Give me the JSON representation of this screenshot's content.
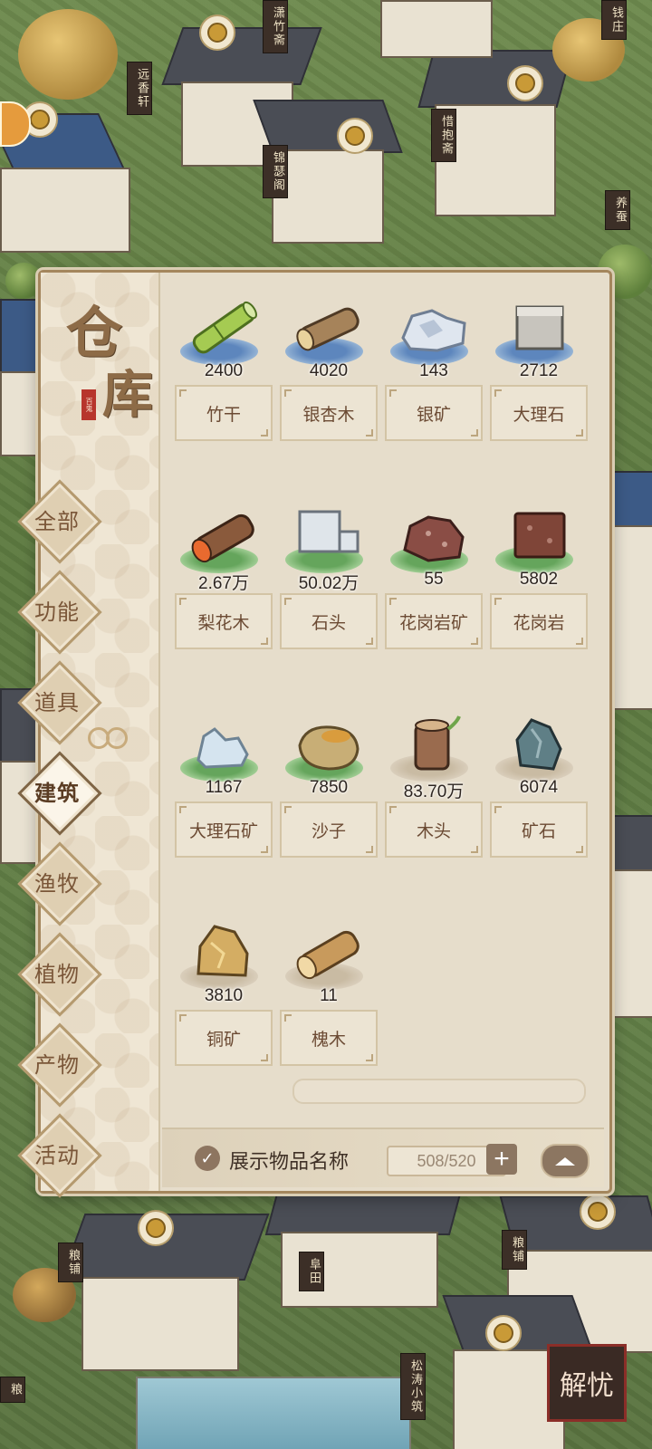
{
  "panel": {
    "title_char_1": "仓",
    "title_char_2": "库",
    "seal_text": "百鬼"
  },
  "categories": [
    {
      "label": "全部",
      "active": false
    },
    {
      "label": "功能",
      "active": false
    },
    {
      "label": "道具",
      "active": false
    },
    {
      "label": "建筑",
      "active": true
    },
    {
      "label": "渔牧",
      "active": false
    },
    {
      "label": "植物",
      "active": false
    },
    {
      "label": "产物",
      "active": false
    },
    {
      "label": "活动",
      "active": false
    }
  ],
  "items": [
    {
      "name": "竹干",
      "qty": "2400",
      "icon": "bamboo-icon"
    },
    {
      "name": "银杏木",
      "qty": "4020",
      "icon": "ginkgo-log-icon"
    },
    {
      "name": "银矿",
      "qty": "143",
      "icon": "silver-ore-icon"
    },
    {
      "name": "大理石",
      "qty": "2712",
      "icon": "marble-block-icon"
    },
    {
      "name": "梨花木",
      "qty": "2.67万",
      "icon": "pear-wood-icon"
    },
    {
      "name": "石头",
      "qty": "50.02万",
      "icon": "stone-block-icon"
    },
    {
      "name": "花岗岩矿",
      "qty": "55",
      "icon": "granite-ore-icon"
    },
    {
      "name": "花岗岩",
      "qty": "5802",
      "icon": "granite-block-icon"
    },
    {
      "name": "大理石矿",
      "qty": "1167",
      "icon": "marble-ore-icon"
    },
    {
      "name": "沙子",
      "qty": "7850",
      "icon": "sand-bag-icon"
    },
    {
      "name": "木头",
      "qty": "83.70万",
      "icon": "wood-stump-icon"
    },
    {
      "name": "矿石",
      "qty": "6074",
      "icon": "ore-icon"
    },
    {
      "name": "铜矿",
      "qty": "3810",
      "icon": "copper-ore-icon"
    },
    {
      "name": "槐木",
      "qty": "11",
      "icon": "locust-wood-icon"
    }
  ],
  "footer": {
    "show_names_label": "展示物品名称",
    "show_names_checked": true,
    "capacity": "508/520"
  },
  "town_signs": [
    "潇竹斋",
    "远香轩",
    "锦瑟阁",
    "惜抱斋",
    "钱庄",
    "养蚕",
    "粮铺",
    "阜田",
    "粮铺",
    "松涛小筑",
    "粮"
  ],
  "jieyou_button": "解忧"
}
